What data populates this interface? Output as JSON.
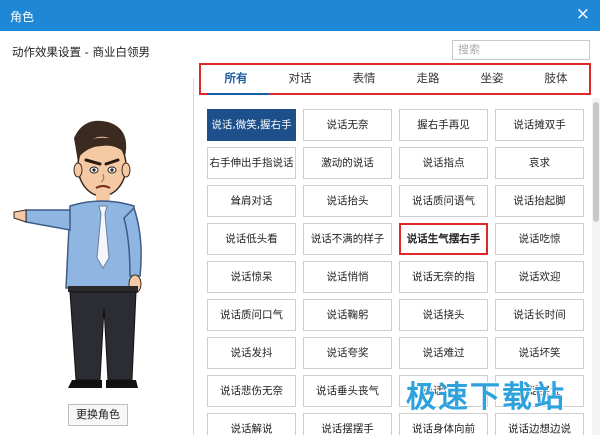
{
  "window": {
    "title": "角色",
    "close_glyph": "×"
  },
  "panel": {
    "title": "动作效果设置 - 商业白领男"
  },
  "search": {
    "placeholder": "搜索"
  },
  "tabs": [
    {
      "label": "所有",
      "active": true
    },
    {
      "label": "对话"
    },
    {
      "label": "表情"
    },
    {
      "label": "走路"
    },
    {
      "label": "坐姿"
    },
    {
      "label": "肢体"
    }
  ],
  "actions": [
    "说话,微笑,握右手",
    "说话无奈",
    "握右手再见",
    "说话摊双手",
    "右手伸出手指说话",
    "激动的说话",
    "说话指点",
    "哀求",
    "耸肩对话",
    "说话抬头",
    "说话质问语气",
    "说话抬起脚",
    "说话低头看",
    "说话不满的样子",
    "说话生气摆右手",
    "说话吃惊",
    "说话惊呆",
    "说话悄悄",
    "说话无奈的指",
    "说话欢迎",
    "说话质问口气",
    "说话鞠躬",
    "说话挠头",
    "说话长时间",
    "说话发抖",
    "说话夸奖",
    "说话难过",
    "说话坏笑",
    "说话悲伤无奈",
    "说话垂头丧气",
    "说话惊讶",
    "说话哭泣",
    "说话解说",
    "说话摆摆手",
    "说话身体向前",
    "说话边想边说"
  ],
  "selected_action_index": 0,
  "highlighted_action_index": 14,
  "change_character_button": "更换角色",
  "watermark": {
    "text": "极速下载站"
  },
  "colors": {
    "titlebar": "#1e88d6",
    "selected": "#1d4f8a",
    "highlight_border": "#e02828",
    "tab_active": "#1a5fa5",
    "watermark": "#2da2dd"
  },
  "icons": {
    "close": "close-icon"
  }
}
